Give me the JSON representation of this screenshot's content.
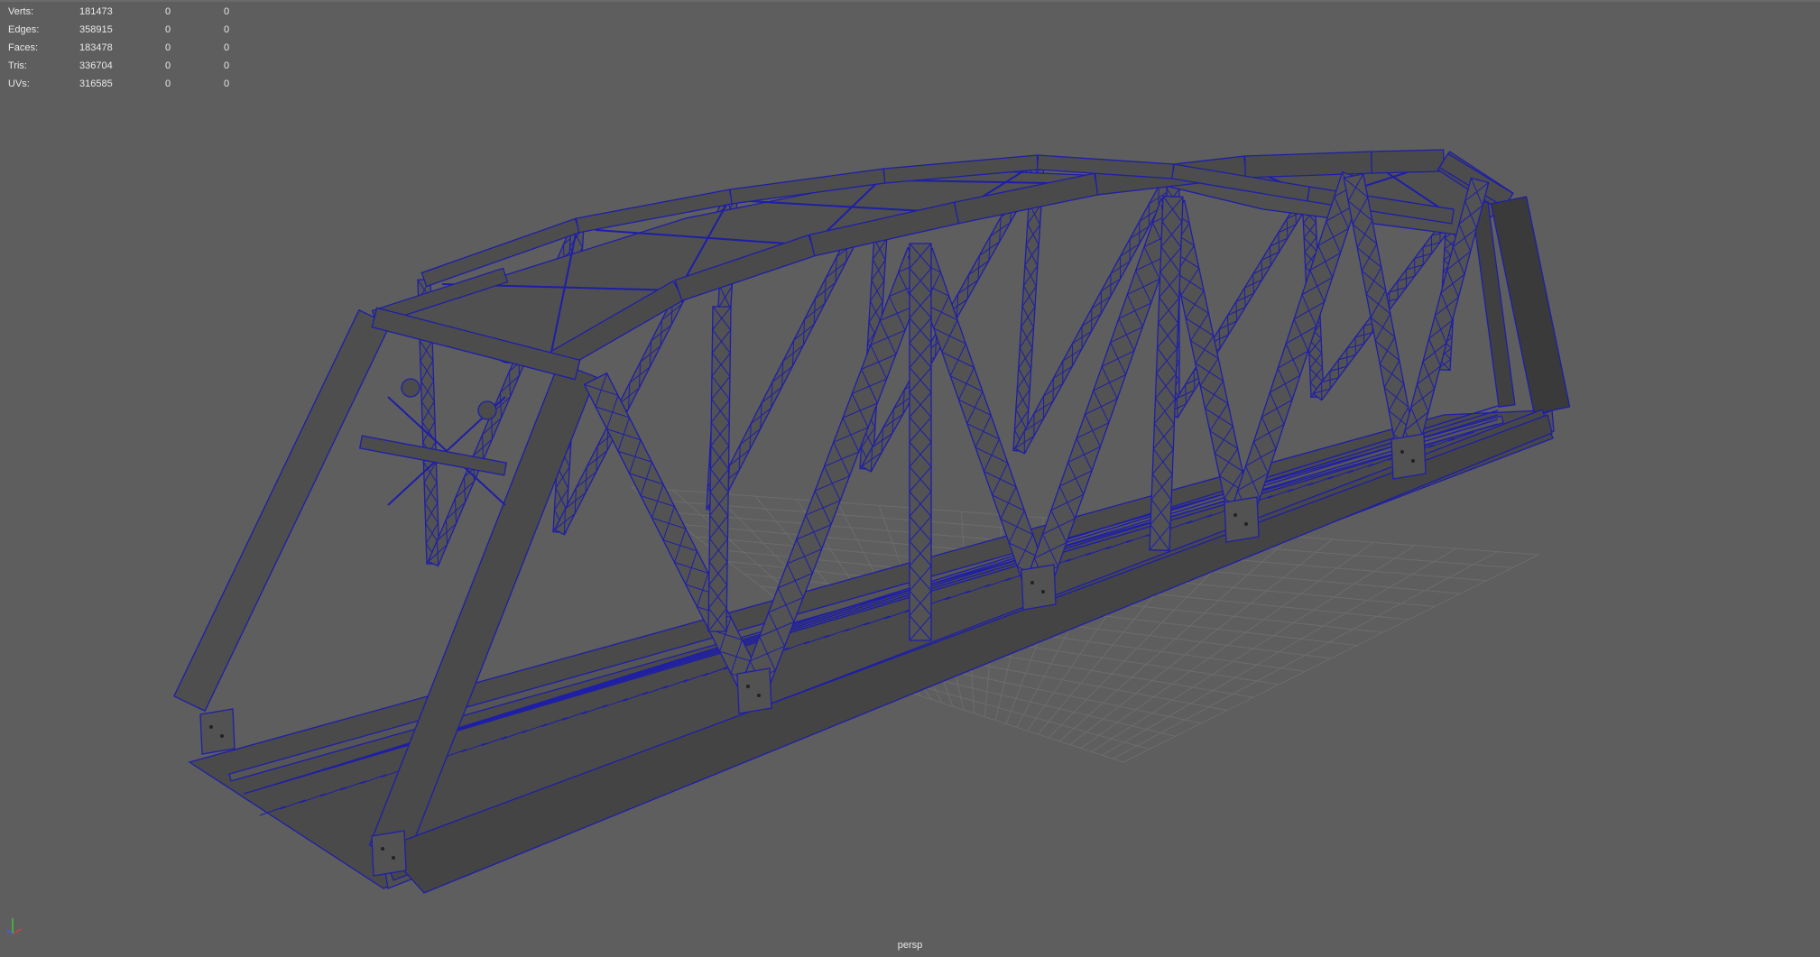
{
  "hud": {
    "rows": [
      {
        "label": "Verts:",
        "value": "181473",
        "sel": "0",
        "comp": "0"
      },
      {
        "label": "Edges:",
        "value": "358915",
        "sel": "0",
        "comp": "0"
      },
      {
        "label": "Faces:",
        "value": "183478",
        "sel": "0",
        "comp": "0"
      },
      {
        "label": "Tris:",
        "value": "336704",
        "sel": "0",
        "comp": "0"
      },
      {
        "label": "UVs:",
        "value": "316585",
        "sel": "0",
        "comp": "0"
      }
    ]
  },
  "viewport": {
    "camera_label": "persp",
    "background_color": "#5e5e5e",
    "wire_color": "#1e1ea8",
    "mesh_color": "#4c4c4c"
  },
  "axis_gizmo": {
    "x_color": "#d04040",
    "y_color": "#40c040",
    "z_color": "#4060e0"
  }
}
